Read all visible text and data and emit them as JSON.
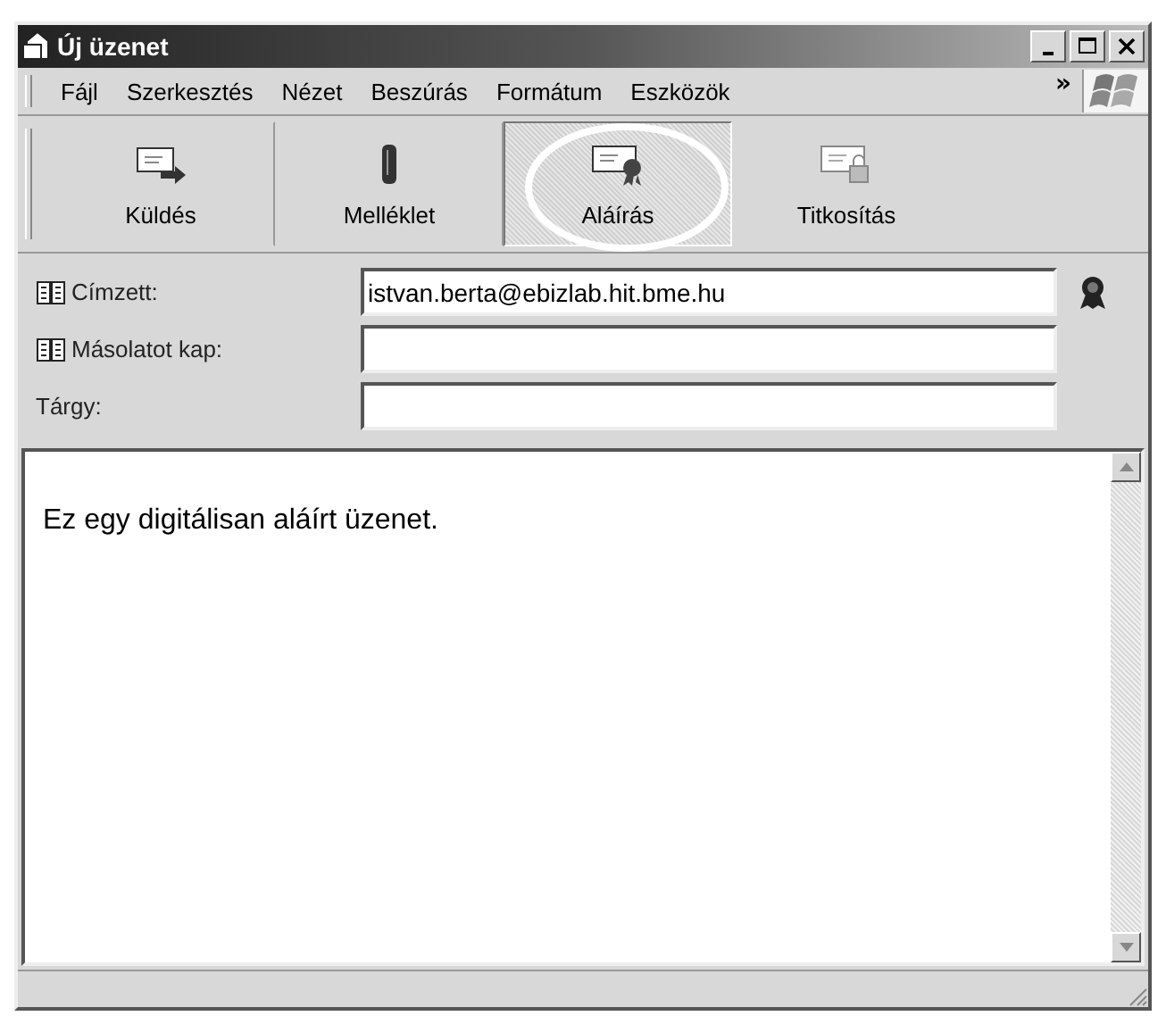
{
  "window": {
    "title": "Új üzenet"
  },
  "menu": [
    {
      "label": "Fájl"
    },
    {
      "label": "Szerkesztés"
    },
    {
      "label": "Nézet"
    },
    {
      "label": "Beszúrás"
    },
    {
      "label": "Formátum"
    },
    {
      "label": "Eszközök"
    }
  ],
  "menu_overflow": "»",
  "toolbar": [
    {
      "label": "Küldés",
      "kind": "send",
      "selected": false
    },
    {
      "label": "Melléklet",
      "kind": "attach",
      "selected": false
    },
    {
      "label": "Aláírás",
      "kind": "sign",
      "selected": true
    },
    {
      "label": "Titkosítás",
      "kind": "encrypt",
      "selected": false
    }
  ],
  "fields": [
    {
      "label": "Címzett:",
      "book": true,
      "value": "istvan.berta@ebizlab.hit.bme.hu",
      "certificate": true
    },
    {
      "label": "Másolatot kap:",
      "book": true,
      "certificate": false
    },
    {
      "label": "Tárgy:",
      "book": false,
      "certificate": false
    }
  ],
  "body": "Ez egy digitálisan aláírt üzenet."
}
